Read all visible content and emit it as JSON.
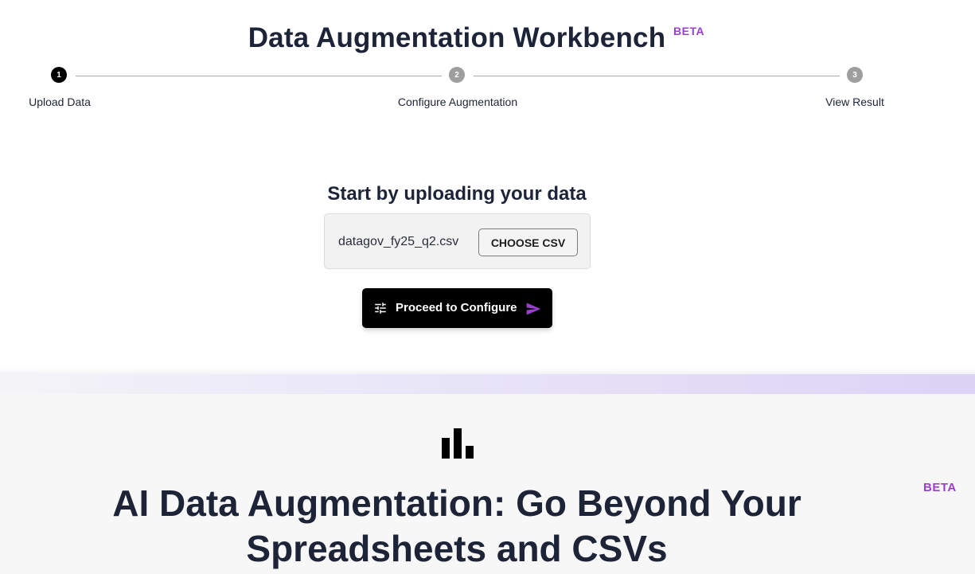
{
  "header": {
    "title": "Data Augmentation Workbench",
    "badge": "BETA"
  },
  "stepper": {
    "steps": [
      {
        "number": "1",
        "label": "Upload Data",
        "state": "active"
      },
      {
        "number": "2",
        "label": "Configure Augmentation",
        "state": "inactive"
      },
      {
        "number": "3",
        "label": "View Result",
        "state": "inactive"
      }
    ]
  },
  "upload": {
    "title": "Start by uploading your data",
    "file_name": "datagov_fy25_q2.csv",
    "choose_label": "CHOOSE CSV",
    "proceed_label": "Proceed to Configure"
  },
  "hero": {
    "icon": "bar-chart-icon",
    "title_line1": "AI Data Augmentation: Go Beyond Your",
    "title_line2": "Spreadsheets and CSVs",
    "badge": "BETA"
  },
  "colors": {
    "accent": "#9b3fd1",
    "primary_button": "#000000",
    "heading": "#1d2438"
  }
}
